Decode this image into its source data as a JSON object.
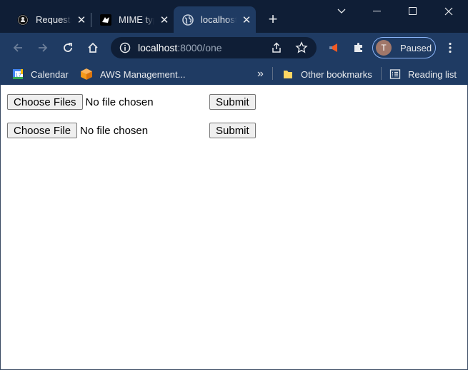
{
  "tabs": [
    {
      "title": "Requests",
      "favicon": "github-icon",
      "close": "✕"
    },
    {
      "title": "MIME types",
      "favicon": "mdn-icon",
      "close": "✕"
    },
    {
      "title": "localhost",
      "favicon": "globe-icon",
      "close": "✕",
      "active": true
    }
  ],
  "new_tab_label": "+",
  "window_controls": {
    "minimize": "—",
    "maximize": "☐",
    "close": "✕"
  },
  "omnibox": {
    "host": "localhost",
    "rest": ":8000/one"
  },
  "profile": {
    "initial": "T",
    "label": "Paused"
  },
  "bookmarks": {
    "items": [
      {
        "label": "Calendar",
        "icon": "calendar-icon"
      },
      {
        "label": "AWS Management..."
      }
    ],
    "overflow": "»",
    "other": "Other bookmarks",
    "reading_list": "Reading list"
  },
  "form1": {
    "choose_label": "Choose Files",
    "status": "No file chosen",
    "submit": "Submit"
  },
  "form2": {
    "choose_label": "Choose File",
    "status": "No file chosen",
    "submit": "Submit"
  },
  "colors": {
    "frame": "#0f1e36",
    "toolbar": "#1f3b63",
    "accent": "#8ab4f8"
  }
}
